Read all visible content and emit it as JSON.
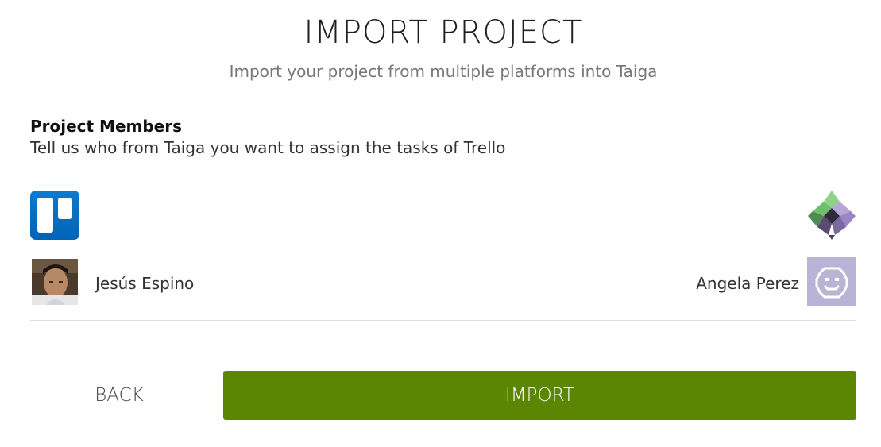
{
  "header": {
    "title": "IMPORT PROJECT",
    "subtitle": "Import your project from multiple platforms into Taiga"
  },
  "members_section": {
    "title": "Project Members",
    "description": "Tell us who from Taiga you want to assign the tasks of Trello",
    "source_platform_icon": "trello-logo-icon",
    "target_platform_icon": "taiga-logo-icon",
    "mappings": [
      {
        "source_user": "Jesús Espino",
        "source_avatar_icon": "user-photo-avatar",
        "target_user": "Angela Perez",
        "target_avatar_icon": "pixel-smiley-avatar"
      }
    ]
  },
  "actions": {
    "back_label": "BACK",
    "import_label": "IMPORT"
  },
  "colors": {
    "import_button": "#5b8602",
    "trello_blue": "#0079bf",
    "divider": "#dddddd"
  }
}
